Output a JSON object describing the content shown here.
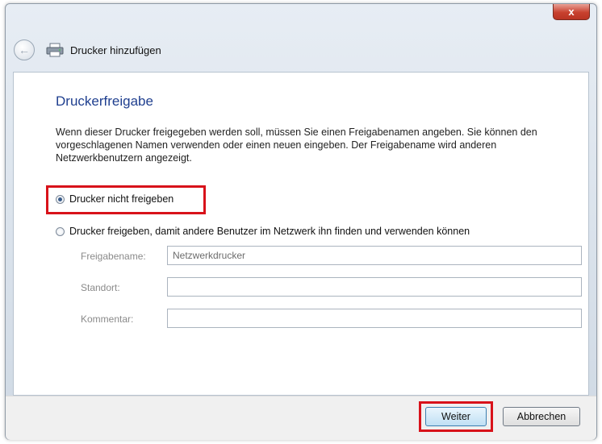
{
  "window": {
    "title": "Drucker hinzufügen",
    "close_label": "x"
  },
  "page": {
    "heading": "Druckerfreigabe",
    "intro": "Wenn dieser Drucker freigegeben werden soll, müssen Sie einen Freigabenamen angeben. Sie können den vorgeschlagenen Namen verwenden oder einen neuen eingeben. Der Freigabename wird anderen Netzwerkbenutzern angezeigt."
  },
  "options": {
    "no_share": {
      "label": "Drucker nicht freigeben",
      "selected": true
    },
    "share": {
      "label": "Drucker freigeben, damit andere Benutzer im Netzwerk ihn finden und verwenden können",
      "selected": false
    }
  },
  "fields": {
    "share_name": {
      "label": "Freigabename:",
      "value": "Netzwerkdrucker"
    },
    "location": {
      "label": "Standort:",
      "value": ""
    },
    "comment": {
      "label": "Kommentar:",
      "value": ""
    }
  },
  "buttons": {
    "next": "Weiter",
    "cancel": "Abbrechen"
  },
  "colors": {
    "highlight": "#d8121a",
    "heading": "#1f3f8f"
  },
  "icons": {
    "back": "back-arrow-icon",
    "wizard": "printer-icon"
  }
}
